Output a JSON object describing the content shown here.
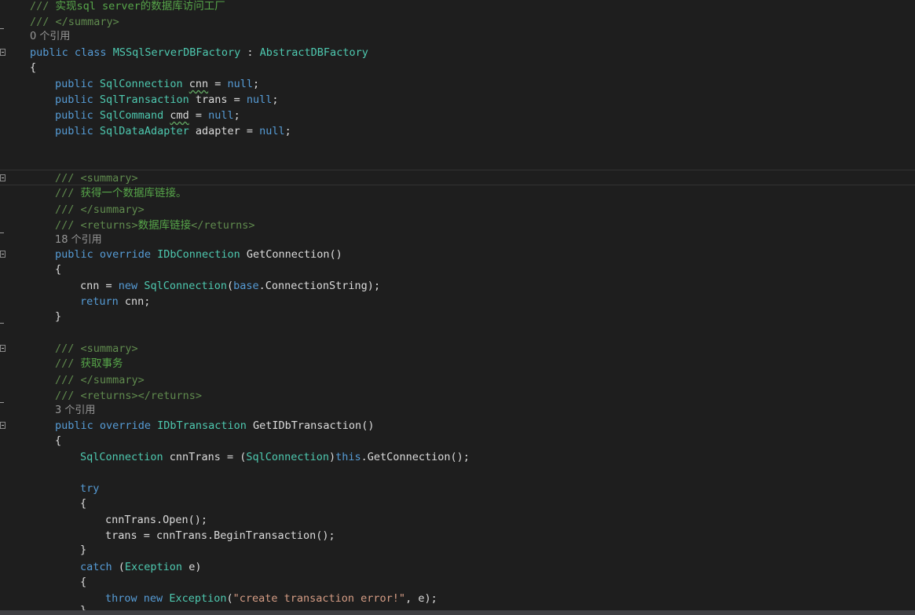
{
  "lines": [
    [
      "/// ",
      "实现sql server的数据库访问工厂"
    ],
    [
      "/// ",
      "</summary>"
    ],
    [
      "0 个引用"
    ],
    [
      "public",
      " ",
      "class",
      " ",
      "MSSqlServerDBFactory",
      " : ",
      "AbstractDBFactory"
    ],
    [
      "{"
    ],
    [
      "public",
      " ",
      "SqlConnection",
      " ",
      "cnn",
      " = ",
      "null",
      ";"
    ],
    [
      "public",
      " ",
      "SqlTransaction",
      " trans = ",
      "null",
      ";"
    ],
    [
      "public",
      " ",
      "SqlCommand",
      " ",
      "cmd",
      " = ",
      "null",
      ";"
    ],
    [
      "public",
      " ",
      "SqlDataAdapter",
      " adapter = ",
      "null",
      ";"
    ],
    [
      "/// ",
      "<summary>"
    ],
    [
      "/// ",
      "获得一个数据库链接。"
    ],
    [
      "/// ",
      "</summary>"
    ],
    [
      "/// ",
      "<returns>",
      "数据库链接",
      "</returns>"
    ],
    [
      "18 个引用"
    ],
    [
      "public",
      " ",
      "override",
      " ",
      "IDbConnection",
      " GetConnection()"
    ],
    [
      "{"
    ],
    [
      "cnn = ",
      "new",
      " ",
      "SqlConnection",
      "(",
      "base",
      ".ConnectionString);"
    ],
    [
      "return",
      " cnn;"
    ],
    [
      "}"
    ],
    [
      "/// ",
      "<summary>"
    ],
    [
      "/// ",
      "获取事务"
    ],
    [
      "/// ",
      "</summary>"
    ],
    [
      "/// ",
      "<returns>",
      "</returns>"
    ],
    [
      "3 个引用"
    ],
    [
      "public",
      " ",
      "override",
      " ",
      "IDbTransaction",
      " GetIDbTransaction()"
    ],
    [
      "{"
    ],
    [
      "SqlConnection",
      " cnnTrans = (",
      "SqlConnection",
      ")",
      "this",
      ".GetConnection();"
    ],
    [
      "try"
    ],
    [
      "{"
    ],
    [
      "cnnTrans.Open();"
    ],
    [
      "trans = cnnTrans.BeginTransaction();"
    ],
    [
      "}"
    ],
    [
      "catch",
      " (",
      "Exception",
      " e)"
    ],
    [
      "{"
    ],
    [
      "throw",
      " ",
      "new",
      " ",
      "Exception",
      "(",
      "\"create transaction error!\"",
      ", e);"
    ],
    [
      "}"
    ]
  ]
}
